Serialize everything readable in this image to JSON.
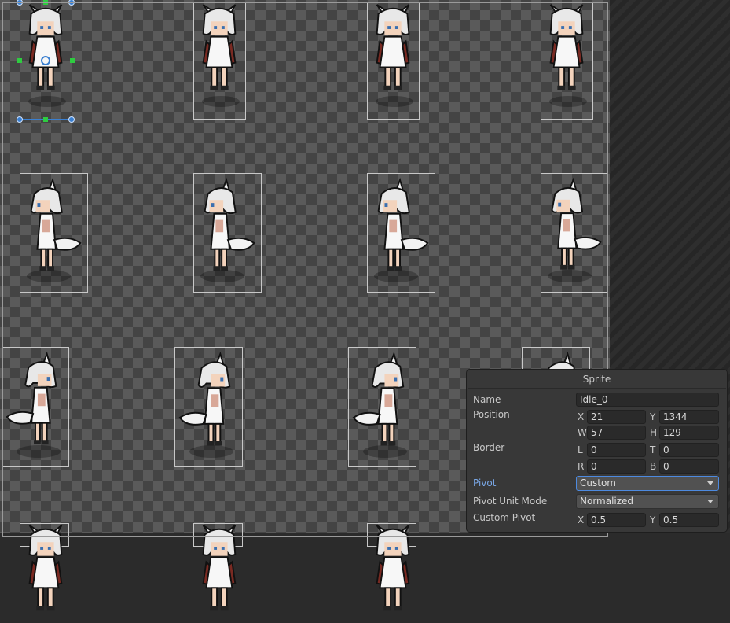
{
  "inspector": {
    "title": "Sprite",
    "name_label": "Name",
    "name_value": "Idle_0",
    "position_label": "Position",
    "x_label": "X",
    "x_value": "21",
    "y_label": "Y",
    "y_value": "1344",
    "w_label": "W",
    "w_value": "57",
    "h_label": "H",
    "h_value": "129",
    "border_label": "Border",
    "l_label": "L",
    "l_value": "0",
    "t_label": "T",
    "t_value": "0",
    "r_label": "R",
    "r_value": "0",
    "b_label": "B",
    "b_value": "0",
    "pivot_label": "Pivot",
    "pivot_value": "Custom",
    "pivot_unit_label": "Pivot Unit Mode",
    "pivot_unit_value": "Normalized",
    "custom_pivot_label": "Custom Pivot",
    "cp_x_label": "X",
    "cp_x_value": "0.5",
    "cp_y_label": "Y",
    "cp_y_value": "0.5"
  },
  "colors": {
    "selection": "#3a7fd0",
    "pivot_label_accent": "#7aa8e8",
    "handle_mid": "#2ecc40"
  },
  "sprites": {
    "rows": [
      [
        "front-idle",
        "front-idle",
        "front-idle",
        "front-idle"
      ],
      [
        "side-right",
        "side-right",
        "side-right",
        "side-right"
      ],
      [
        "side-left",
        "side-left",
        "side-left",
        "side-left"
      ],
      [
        "partial",
        "partial",
        "partial"
      ]
    ],
    "selected_index": 0
  }
}
